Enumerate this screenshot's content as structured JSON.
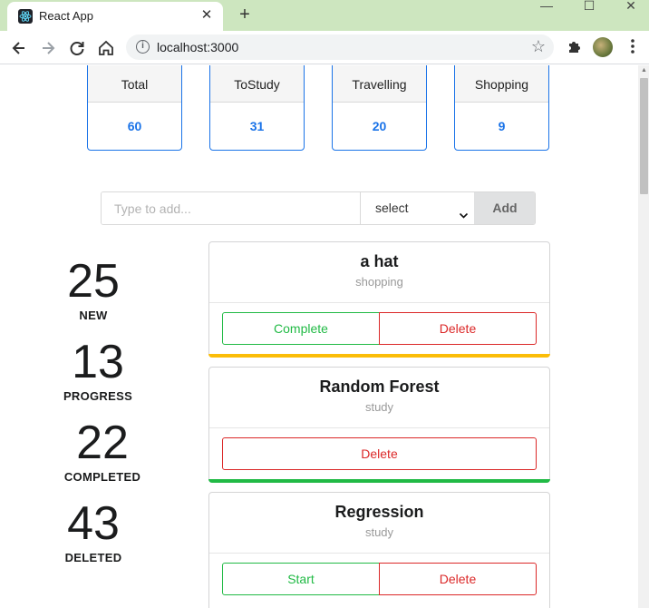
{
  "browser": {
    "tab_title": "React App",
    "tab_close": "✕",
    "new_tab": "+",
    "url": "localhost:3000",
    "window_controls": {
      "minimize": "—",
      "maximize": "☐",
      "close": "✕"
    }
  },
  "summary": [
    {
      "label": "Total",
      "value": "60"
    },
    {
      "label": "ToStudy",
      "value": "31"
    },
    {
      "label": "Travelling",
      "value": "20"
    },
    {
      "label": "Shopping",
      "value": "9"
    }
  ],
  "add_form": {
    "placeholder": "Type to add...",
    "select_value": "select",
    "add_label": "Add"
  },
  "stats": [
    {
      "value": "25",
      "label": "NEW"
    },
    {
      "value": "13",
      "label": "PROGRESS"
    },
    {
      "value": "22",
      "label": "COMPLETED"
    },
    {
      "value": "43",
      "label": "DELETED"
    }
  ],
  "items": [
    {
      "title": "a hat",
      "category": "shopping",
      "left_action": "Complete",
      "right_action": "Delete",
      "bar_color": "#fbbd08"
    },
    {
      "title": "Random Forest",
      "category": "study",
      "action": "Delete",
      "bar_color": "#21ba45"
    },
    {
      "title": "Regression",
      "category": "study",
      "left_action": "Start",
      "right_action": "Delete"
    }
  ],
  "colors": {
    "accent_blue": "#1a73e8",
    "green": "#21ba45",
    "red": "#db2828",
    "yellow": "#fbbd08",
    "titlebar": "#cde6bf"
  },
  "icons": {
    "back": "back-arrow-icon",
    "forward": "forward-arrow-icon",
    "reload": "reload-icon",
    "home": "home-icon",
    "info": "info-icon",
    "star": "star-icon",
    "extensions": "puzzle-icon",
    "menu": "kebab-menu-icon"
  }
}
